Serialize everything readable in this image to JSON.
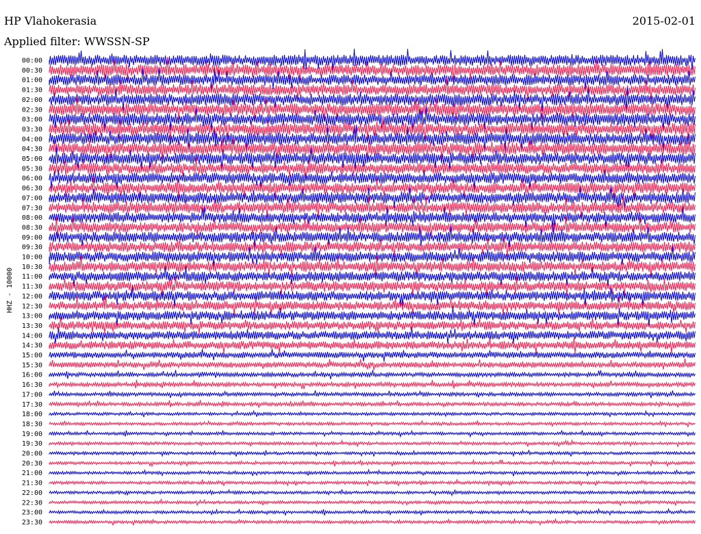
{
  "header": {
    "station": "HP Vlahokerasia",
    "date": "2015-02-01",
    "filter_label": "Applied filter: WWSSN-SP"
  },
  "chart_data": {
    "type": "line",
    "title": "HP Vlahokerasia",
    "channel_label": "HHZ - 10000",
    "filter": "WWSSN-SP",
    "date": "2015-02-01",
    "ytick_labels": [
      "00:00",
      "00:30",
      "01:00",
      "01:30",
      "02:00",
      "02:30",
      "03:00",
      "03:30",
      "04:00",
      "04:30",
      "05:00",
      "05:30",
      "06:00",
      "06:30",
      "07:00",
      "07:30",
      "08:00",
      "08:30",
      "09:00",
      "09:30",
      "10:00",
      "10:30",
      "11:00",
      "11:30",
      "12:00",
      "12:30",
      "13:00",
      "13:30",
      "14:00",
      "14:30",
      "15:00",
      "15:30",
      "16:00",
      "16:30",
      "17:00",
      "17:30",
      "18:00",
      "18:30",
      "19:00",
      "19:30",
      "20:00",
      "20:30",
      "21:00",
      "21:30",
      "22:00",
      "22:30",
      "23:00",
      "23:30"
    ],
    "series_colors": [
      "#0000e8",
      "#ff1a4d"
    ],
    "grid": false,
    "legend": "none",
    "trace_amplitude": [
      0.9,
      0.95,
      0.9,
      0.9,
      0.95,
      1.0,
      1.0,
      1.0,
      1.0,
      1.0,
      0.95,
      0.9,
      0.9,
      0.9,
      0.9,
      0.9,
      0.85,
      0.85,
      0.85,
      0.85,
      0.85,
      0.85,
      0.8,
      0.8,
      0.8,
      0.75,
      0.75,
      0.7,
      0.7,
      0.65,
      0.5,
      0.45,
      0.35,
      0.35,
      0.3,
      0.3,
      0.25,
      0.25,
      0.25,
      0.25,
      0.25,
      0.25,
      0.25,
      0.25,
      0.25,
      0.25,
      0.25,
      0.25
    ]
  }
}
